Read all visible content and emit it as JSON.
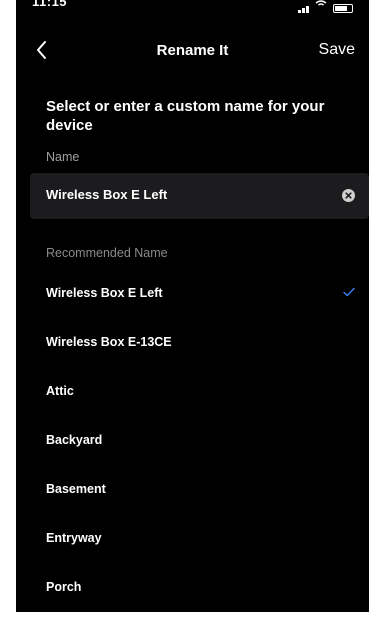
{
  "status": {
    "time": "11:15"
  },
  "header": {
    "title": "Rename It",
    "save_label": "Save"
  },
  "prompt": "Select or enter a custom name for your device",
  "name_field": {
    "label": "Name",
    "value": "Wireless Box E Left"
  },
  "recommended": {
    "label": "Recommended Name",
    "selected_index": 0,
    "items": [
      {
        "label": "Wireless Box E Left"
      },
      {
        "label": "Wireless Box E-13CE"
      },
      {
        "label": "Attic"
      },
      {
        "label": "Backyard"
      },
      {
        "label": "Basement"
      },
      {
        "label": "Entryway"
      },
      {
        "label": "Porch"
      }
    ]
  },
  "colors": {
    "background": "#000000",
    "field_background": "#1c1c1e",
    "check_accent": "#3b82f6",
    "muted_text": "#8a8a8a"
  }
}
